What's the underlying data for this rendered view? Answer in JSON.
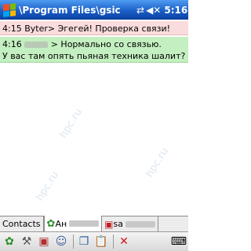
{
  "titlebar": {
    "path": "\\Program Files\\gsic",
    "time": "5:16",
    "icons": [
      "start-flag-icon",
      "connectivity-icon",
      "speaker-icon"
    ]
  },
  "messages": [
    {
      "time": "4:15",
      "sender": "Byter",
      "text": "> Эгегей! Проверка связи!"
    },
    {
      "time": "4:16",
      "text_line1": "> Нормально со связью.",
      "text_line2": "У вас там опять пьяная техника шалит?"
    }
  ],
  "watermark": "hpc.ru",
  "tabs": [
    {
      "label": "Contacts"
    },
    {
      "label": "Ан"
    },
    {
      "label": "sa"
    }
  ],
  "toolbar": {
    "icons": [
      "flower-icon",
      "tools-icon",
      "contact-card-icon",
      "user-info-icon",
      "copy-icon",
      "paste-icon",
      "close-icon",
      "keyboard-icon"
    ]
  },
  "colors": {
    "titlebar": "#1a5fc8",
    "incoming_bg": "#fadcdc",
    "outgoing_bg": "#c4efc0"
  }
}
